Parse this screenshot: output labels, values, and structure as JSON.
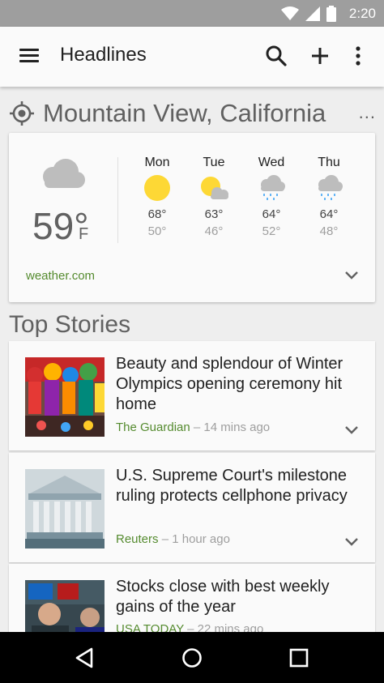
{
  "status_bar": {
    "time": "2:20"
  },
  "app_bar": {
    "title": "Headlines"
  },
  "location": {
    "name": "Mountain View, California",
    "more_label": "..."
  },
  "weather": {
    "current_temp": "59°",
    "unit": "F",
    "source": "weather.com",
    "days": [
      {
        "name": "Mon",
        "hi": "68°",
        "lo": "50°",
        "icon": "sun-icon"
      },
      {
        "name": "Tue",
        "hi": "63°",
        "lo": "46°",
        "icon": "partly-cloudy-icon"
      },
      {
        "name": "Wed",
        "hi": "64°",
        "lo": "52°",
        "icon": "rain-icon"
      },
      {
        "name": "Thu",
        "hi": "64°",
        "lo": "48°",
        "icon": "rain-icon"
      }
    ]
  },
  "top_stories": {
    "title": "Top Stories",
    "items": [
      {
        "title": "Beauty and splendour of Winter Olympics opening ceremony hit home",
        "source": "The Guardian",
        "time": "– 14 mins ago"
      },
      {
        "title": "U.S. Supreme Court's milestone ruling protects cellphone privacy",
        "source": "Reuters",
        "time": "– 1 hour ago"
      },
      {
        "title": "Stocks close with best weekly gains of the year",
        "source": "USA TODAY",
        "time": "– 22 mins ago"
      }
    ]
  },
  "colors": {
    "source_green": "#558b2f",
    "sun_yellow": "#fdd835",
    "rain_blue": "#64b5f6",
    "cloud_grey": "#bdbdbd"
  }
}
